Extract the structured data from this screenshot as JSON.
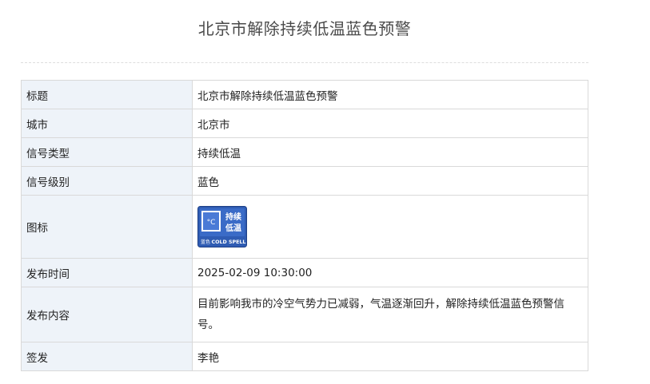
{
  "page": {
    "title": "北京市解除持续低温蓝色预警"
  },
  "table": {
    "rows": [
      {
        "label": "标题",
        "value": "北京市解除持续低温蓝色预警"
      },
      {
        "label": "城市",
        "value": "北京市"
      },
      {
        "label": "信号类型",
        "value": "持续低温"
      },
      {
        "label": "信号级别",
        "value": "蓝色"
      },
      {
        "label": "图标"
      },
      {
        "label": "发布时间",
        "value": "2025-02-09 10:30:00"
      },
      {
        "label": "发布内容",
        "value": "目前影响我市的冷空气势力已减弱，气温逐渐回升，解除持续低温蓝色预警信号。"
      },
      {
        "label": "签发",
        "value": "李艳"
      }
    ]
  },
  "icon": {
    "name": "cold-spell-blue-signal-icon",
    "symbol": "°C",
    "cn_text": "持续低温",
    "level_text": "蓝色",
    "en_text": "COLD SPELL",
    "colors": {
      "background": "#2f5cb3",
      "border": "#1d3f86",
      "panel": "#ffffff",
      "accent": "#4a7ad6"
    }
  }
}
